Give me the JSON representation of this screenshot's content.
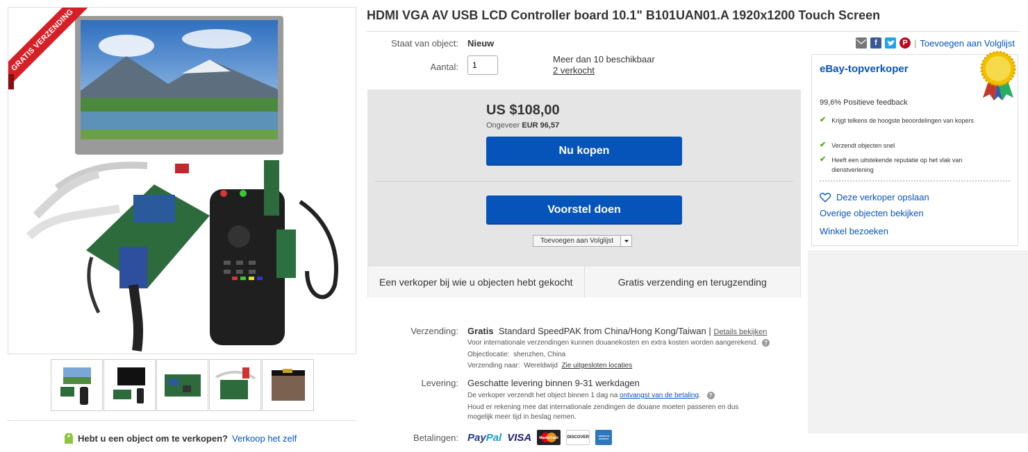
{
  "listing": {
    "title": "HDMI VGA AV USB LCD Controller board 10.1\" B101UAN01.A 1920x1200 Touch Screen",
    "ribbon": "GRATIS VERZENDING"
  },
  "condition": {
    "label": "Staat van object:",
    "value": "Nieuw"
  },
  "quantity": {
    "label": "Aantal:",
    "value": "1",
    "available": "Meer dan 10 beschikbaar",
    "sold": "2 verkocht"
  },
  "price": {
    "usd": "US $108,00",
    "approx_prefix": "Ongeveer",
    "eur": "EUR 96,57"
  },
  "buttons": {
    "buy_now": "Nu kopen",
    "make_offer": "Voorstel doen",
    "add_watchlist": "Toevoegen aan Volglijst"
  },
  "buy_info": {
    "cell1": "Een verkoper bij wie u objecten hebt gekocht",
    "cell2": "Gratis verzending en terugzending"
  },
  "shipping": {
    "label": "Verzending:",
    "price": "Gratis",
    "service": "Standard SpeedPAK from China/Hong Kong/Taiwan |",
    "details_link": "Details bekijken",
    "customs_note": "Voor internationale verzendingen kunnen douanekosten en extra kosten worden aangerekend.",
    "location_label": "Objectlocatie:",
    "location": "shenzhen, China",
    "ships_to_label": "Verzending naar:",
    "ships_to": "Wereldwijd",
    "excluded_link": "Zie uitgesloten locaties"
  },
  "delivery": {
    "label": "Levering:",
    "estimate": "Geschatte levering binnen 9-31 werkdagen",
    "dispatch_text": "De verkoper verzendt het object binnen 1 dag na",
    "dispatch_link": "ontvangst van de betaling",
    "intl_note_1": "Houd er rekening mee dat internationale zendingen de douane moeten passeren en dus",
    "intl_note_2": "mogelijk meer tijd in beslag nemen."
  },
  "payments": {
    "label": "Betalingen:",
    "paypal_a": "Pay",
    "paypal_b": "Pal",
    "visa": "VISA",
    "mastercard": "MasterCard",
    "discover": "DISCOVER",
    "amex": "AMERICAN EXPRESS"
  },
  "share": {
    "watchlist_link": "Toevoegen aan Volglijst"
  },
  "seller": {
    "badge": "eBay-topverkoper",
    "feedback": "99,6% Positieve feedback",
    "points": [
      "Krijgt telkens de hoogste beoordelingen van kopers",
      "Verzendt objecten snel",
      "Heeft een uitstekende reputatie op het vlak van dienstverlening"
    ],
    "save_seller": "Deze verkoper opslaan",
    "other_items": "Overige objecten bekijken",
    "visit_store": "Winkel bezoeken"
  },
  "sell": {
    "question": "Hebt u een object om te verkopen?",
    "link": "Verkoop het zelf"
  },
  "colors": {
    "link": "#0654ba",
    "button": "#0654ba",
    "ribbon": "#d71f27",
    "check": "#5ba51f"
  }
}
